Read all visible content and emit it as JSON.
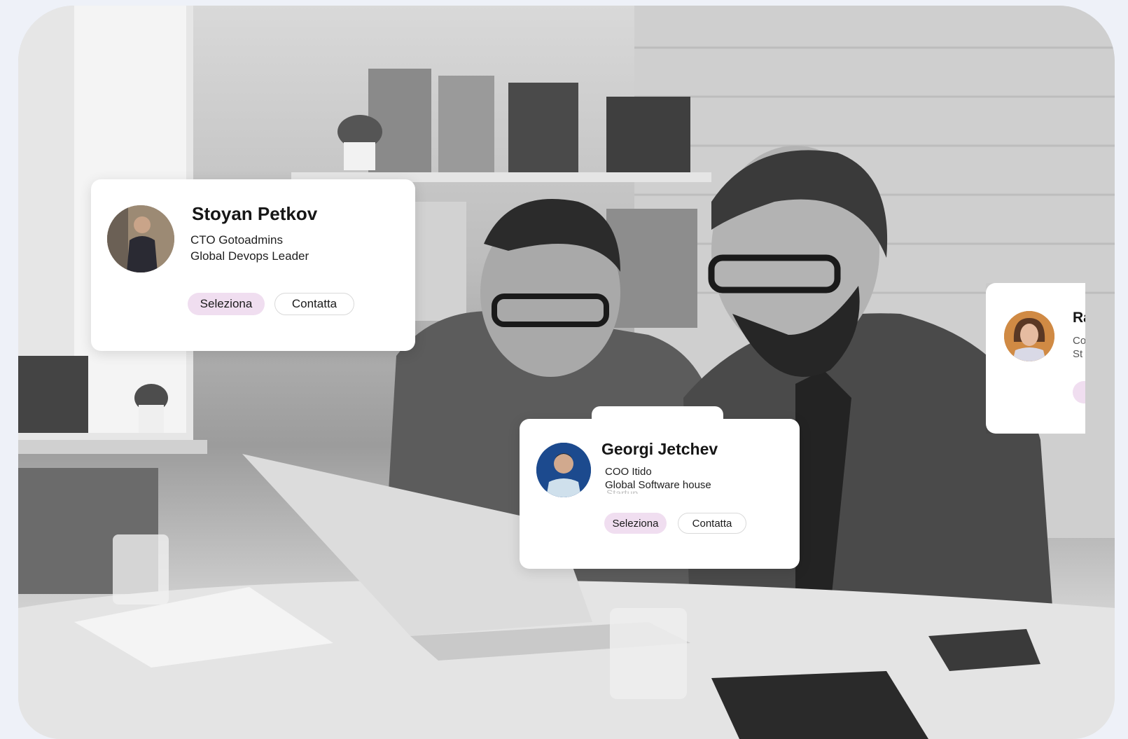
{
  "background": {
    "photo": "black-and-white office photo: two bearded businessmen in suits looking at a laptop on a desk"
  },
  "cards": [
    {
      "name": "Stoyan Petkov",
      "role_line1": "CTO Gotoadmins",
      "role_line2": "Global Devops Leader",
      "select_label": "Seleziona",
      "contact_label": "Contatta"
    },
    {
      "name": "Georgi Jetchev",
      "role_line1": "COO Itido",
      "role_line2": "Global Software house",
      "ghost_text": "Startup",
      "select_label": "Seleziona",
      "contact_label": "Contatta"
    },
    {
      "name": "Ra",
      "role_line1": "Co",
      "role_line2": "St"
    }
  ],
  "colors": {
    "select_button_bg": "#f0def0",
    "card_bg": "#ffffff",
    "page_bg": "#eef1f8"
  }
}
